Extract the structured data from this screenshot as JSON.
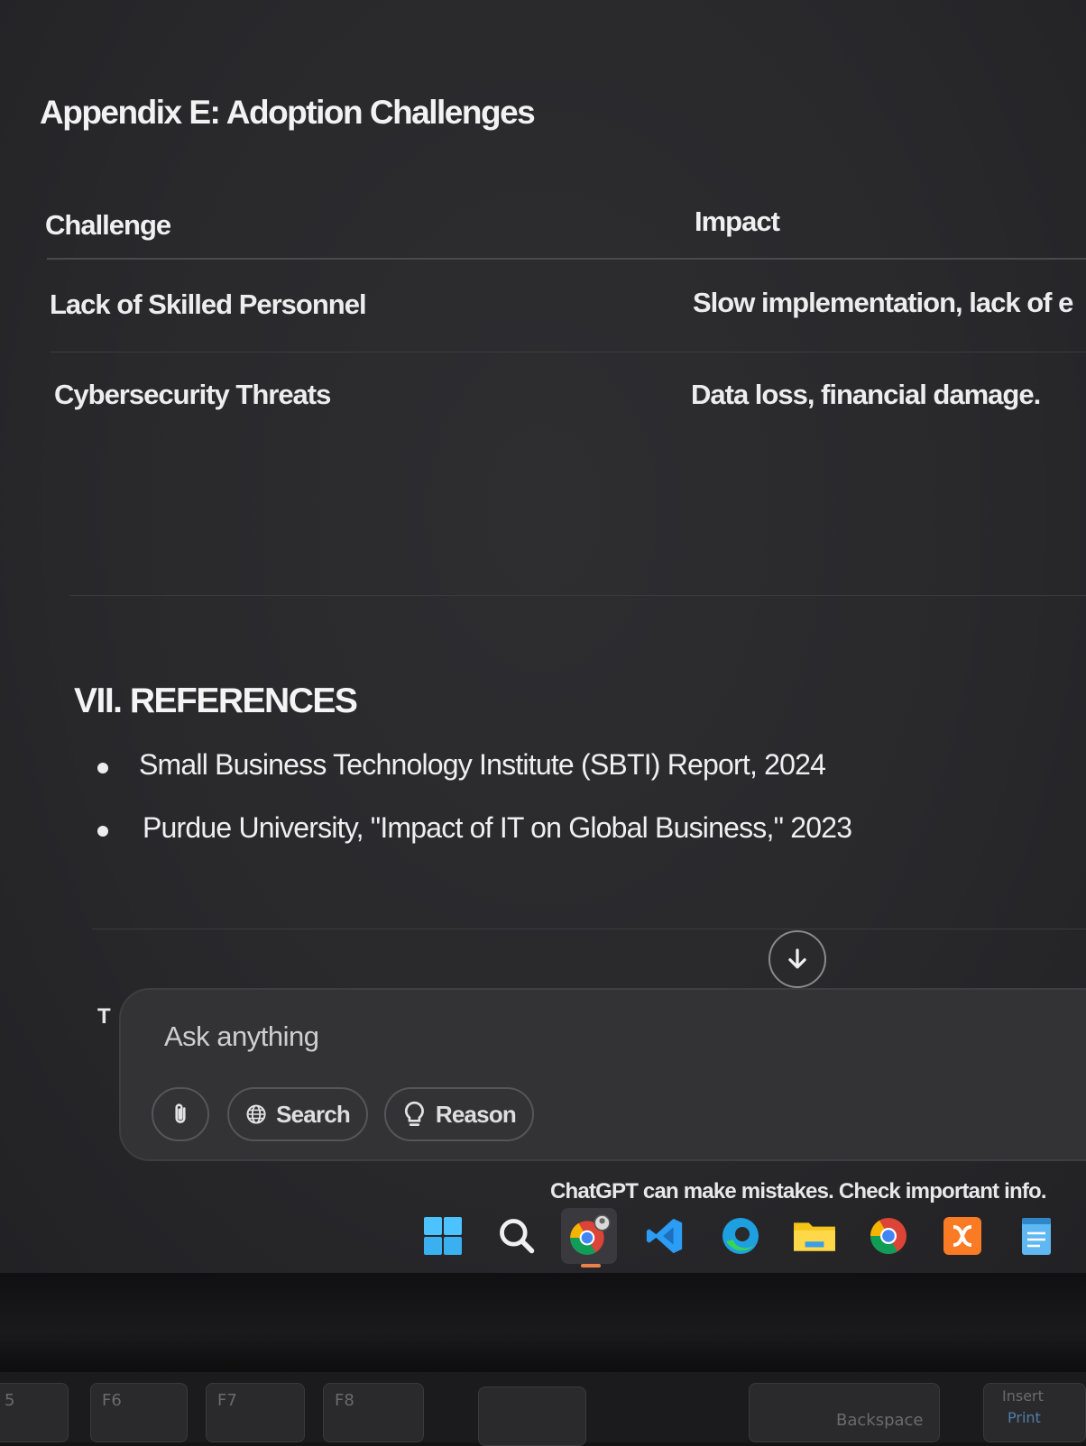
{
  "appendix": {
    "title": "Appendix E: Adoption Challenges",
    "table": {
      "headers": [
        "Challenge",
        "Impact"
      ],
      "rows": [
        [
          "Lack of Skilled Personnel",
          "Slow implementation, lack of e"
        ],
        [
          "Cybersecurity Threats",
          "Data loss, financial damage."
        ]
      ]
    }
  },
  "references": {
    "title": "VII. REFERENCES",
    "items": [
      "Small Business Technology Institute (SBTI) Report, 2024",
      "Purdue University, \"Impact of IT on Global Business,\" 2023"
    ]
  },
  "composer": {
    "peek_text": "T",
    "placeholder": "Ask anything",
    "search_label": "Search",
    "reason_label": "Reason",
    "disclaimer": "ChatGPT can make mistakes. Check important info."
  },
  "taskbar": {
    "icons": [
      "windows-start-icon",
      "search-icon",
      "chrome-profile-icon",
      "vscode-icon",
      "edge-icon",
      "file-explorer-icon",
      "chrome-icon",
      "xampp-icon",
      "notepad-icon"
    ]
  },
  "keyboard": {
    "keys": [
      "5",
      "F6",
      "F7",
      "F8",
      "Backspace",
      "Insert",
      "Print"
    ]
  },
  "colors": {
    "background": "#29292c",
    "composer": "#333336",
    "text": "#ececec",
    "accent_indicator": "#e8814a"
  }
}
